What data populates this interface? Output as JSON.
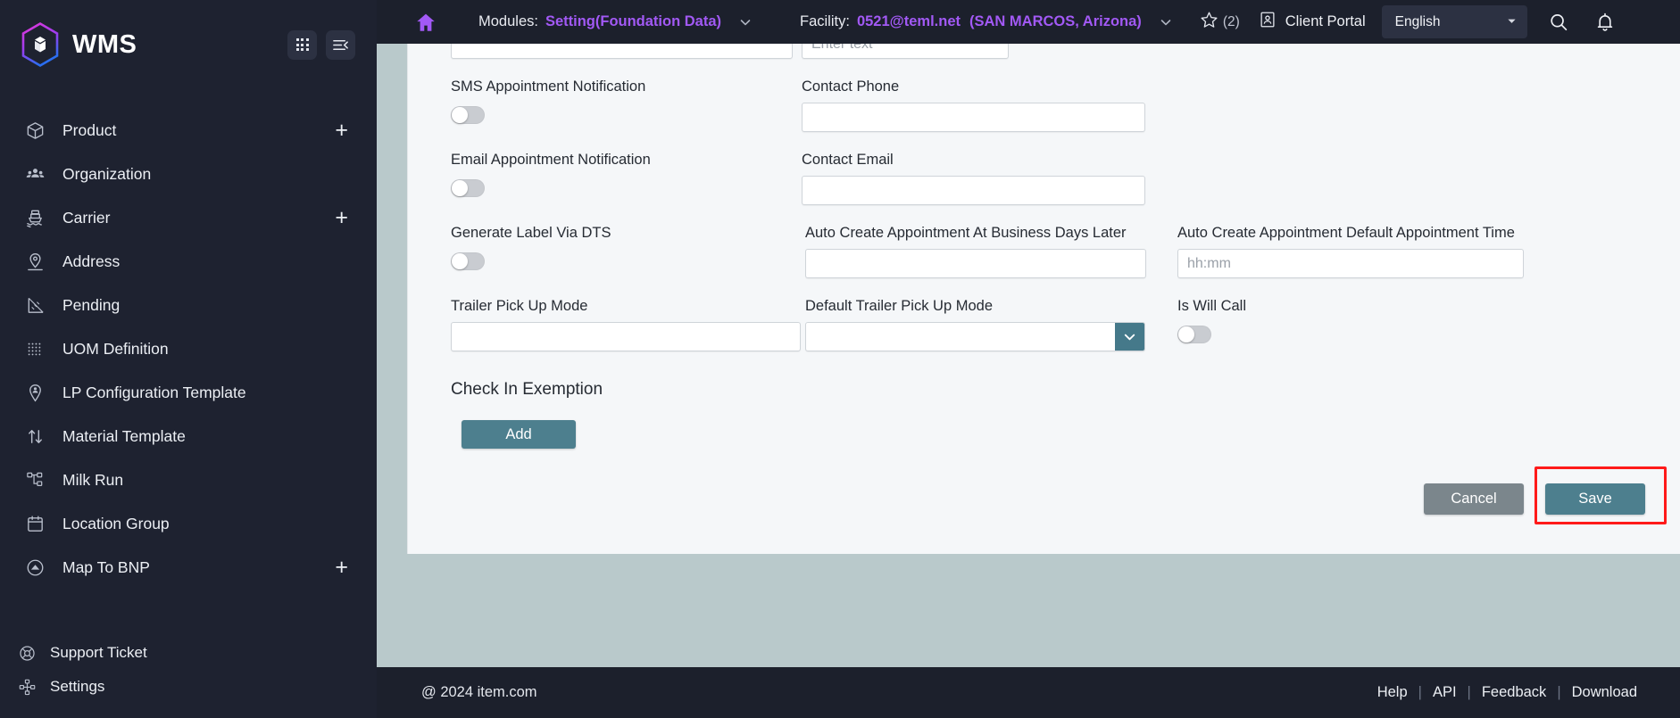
{
  "sidebar": {
    "brand": "WMS",
    "logo_icon": "wms-hex-logo-icon",
    "apps_button_icon": "grid-apps-icon",
    "collapse_button_icon": "collapse-menu-icon",
    "items": [
      {
        "label": "Product",
        "icon": "box-icon",
        "has_plus": true
      },
      {
        "label": "Organization",
        "icon": "people-group-icon",
        "has_plus": false
      },
      {
        "label": "Carrier",
        "icon": "ship-icon",
        "has_plus": true
      },
      {
        "label": "Address",
        "icon": "map-pin-icon",
        "has_plus": false
      },
      {
        "label": "Pending",
        "icon": "triangle-ruler-icon",
        "has_plus": false
      },
      {
        "label": "UOM Definition",
        "icon": "dotted-grid-icon",
        "has_plus": false
      },
      {
        "label": "LP Configuration Template",
        "icon": "pin-person-icon",
        "has_plus": false
      },
      {
        "label": "Material Template",
        "icon": "up-down-arrows-icon",
        "has_plus": false
      },
      {
        "label": "Milk Run",
        "icon": "sitemap-icon",
        "has_plus": false
      },
      {
        "label": "Location Group",
        "icon": "calendar-icon",
        "has_plus": false
      },
      {
        "label": "Map To BNP",
        "icon": "cloud-circle-icon",
        "has_plus": true
      }
    ],
    "bottom_items": [
      {
        "label": "Support Ticket",
        "icon": "lifebuoy-icon"
      },
      {
        "label": "Settings",
        "icon": "settings-nodes-icon"
      }
    ],
    "plus_label": "+"
  },
  "topbar": {
    "home_icon": "home-icon",
    "modules_key": "Modules:",
    "modules_value": "Setting(Foundation Data)",
    "modules_caret_icon": "chevron-down-icon",
    "facility_key": "Facility:",
    "facility_value": "0521@teml.net",
    "facility_location": "(SAN MARCOS, Arizona)",
    "facility_caret_icon": "chevron-down-icon",
    "star_icon": "star-outline-icon",
    "star_count": "(2)",
    "client_portal_icon": "id-card-icon",
    "client_portal_label": "Client Portal",
    "language_value": "English",
    "language_caret_icon": "triangle-down-icon",
    "search_icon": "search-icon",
    "bell_icon": "bell-notification-icon"
  },
  "form": {
    "row0": {
      "left_value": "",
      "right_placeholder": "Enter text",
      "right_value": ""
    },
    "row1": {
      "left_label": "SMS Appointment Notification",
      "left_toggle_on": false,
      "right_label": "Contact Phone",
      "right_value": ""
    },
    "row2": {
      "left_label": "Email Appointment Notification",
      "left_toggle_on": false,
      "right_label": "Contact Email",
      "right_value": ""
    },
    "row3": {
      "left_label": "Generate Label Via DTS",
      "left_toggle_on": false,
      "mid_label": "Auto Create Appointment At Business Days Later",
      "mid_value": "",
      "right_label": "Auto Create Appointment Default Appointment Time",
      "right_placeholder": "hh:mm",
      "right_value": ""
    },
    "row4": {
      "left_label": "Trailer Pick Up Mode",
      "left_value": "",
      "mid_label": "Default Trailer Pick Up Mode",
      "mid_value": "",
      "mid_dropdown_icon": "chevron-down-icon",
      "right_label": "Is Will Call",
      "right_toggle_on": false
    },
    "section": {
      "title": "Check In Exemption",
      "add_label": "Add"
    },
    "actions": {
      "cancel_label": "Cancel",
      "save_label": "Save"
    }
  },
  "footer": {
    "copyright": "@ 2024 item.com",
    "links": [
      "Help",
      "API",
      "Feedback",
      "Download"
    ],
    "separator": "|"
  },
  "colors": {
    "sidebar_bg": "#1e2230",
    "topbar_bg": "#1c202c",
    "accent_purple": "#a259f5",
    "accent_teal": "#4d7f8e",
    "page_bg": "#b9c9cb",
    "card_bg": "#f5f7f9",
    "highlight_red": "#ff1a1a",
    "cancel_gray": "#7b868c"
  }
}
